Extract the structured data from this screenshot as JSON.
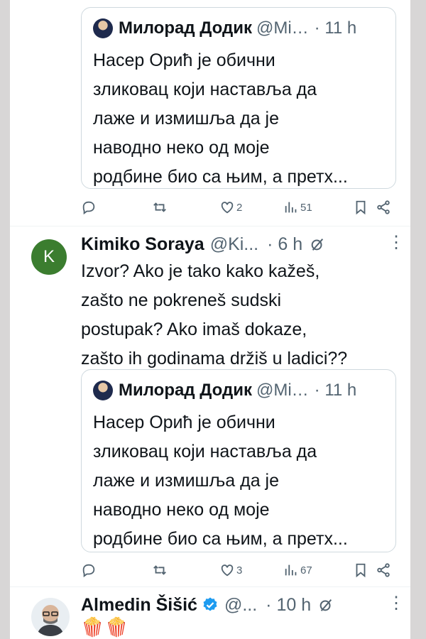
{
  "quoted_tweet": {
    "author_name": "Милорад Додик",
    "handle": "@Mi…",
    "time": "· 11 h",
    "text": "Насер Орић је обични\nзликовац који наставља да\nлаже и измишља да је\nнаводно неко од моје\nродбине био са њим, а претх..."
  },
  "tweet1_actions": {
    "likes": "2",
    "views": "51"
  },
  "reply_kimiko": {
    "avatar_letter": "K",
    "author_name": "Kimiko Soraya",
    "handle": "@Ki...",
    "time": "· 6 h",
    "text": "Izvor? Ako je tako kako kažeš,\nzašto ne pokreneš sudski\npostupak? Ako imaš dokaze,\nzašto ih godinama držiš u ladici??",
    "likes": "3",
    "views": "67"
  },
  "reply_almedin": {
    "author_name": "Almedin Šišić",
    "handle": "@...",
    "time": "· 10 h",
    "text": "🍿🍿"
  },
  "icons": {
    "reply": "reply-icon",
    "retweet": "retweet-icon",
    "like": "heart-icon",
    "views": "views-icon",
    "bookmark": "bookmark-icon",
    "share": "share-icon",
    "grok": "grok-icon",
    "more": "more-icon",
    "verified": "verified-badge-icon"
  },
  "colors": {
    "text": "#0f1419",
    "muted": "#536471",
    "border": "#cfd9de",
    "verified": "#1d9bf0",
    "avatar_k": "#3b7d2f"
  },
  "more_glyph": "⋮"
}
